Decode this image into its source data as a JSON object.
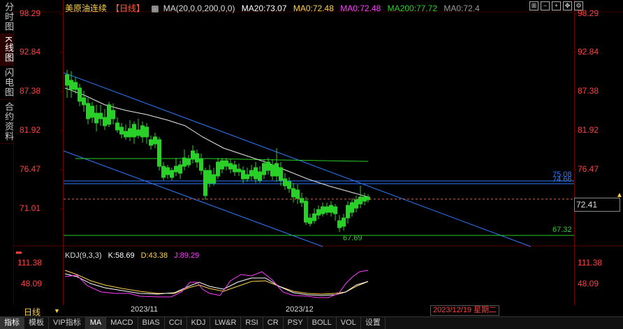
{
  "side_tabs": [
    "分时图",
    "K线图",
    "闪电图",
    "合约资料"
  ],
  "side_active_index": 1,
  "header": {
    "title": "美原油连续",
    "period_tag": "【日线】",
    "ma_params": "MA(20,0,0,200,0,0)",
    "ma20": "MA20:73.07",
    "ma0a": "MA0:72.48",
    "ma0b": "MA0:72.48",
    "ma200": "MA200:77.72",
    "ma0c": "MA0:72.4",
    "colors": {
      "ma20": "#ffffff",
      "ma0a": "#ffd24a",
      "ma0b": "#ff3cff",
      "ma200": "#28d028",
      "ma0c": "#9a9a9a"
    }
  },
  "toolbar_icons": [
    "expand-icon",
    "minus-icon",
    "plus-icon",
    "move-icon",
    "settings-icon"
  ],
  "price_axis": [
    "98.29",
    "92.84",
    "87.38",
    "81.92",
    "76.47",
    "71.01"
  ],
  "current_price": "72.41",
  "level_labels": {
    "upper_a": "75.08",
    "upper_b": "74.66",
    "support": "67.32",
    "low": "67.69"
  },
  "kdj": {
    "title": "KDJ(9,3,3)",
    "k": "K:58.69",
    "d": "D:43.38",
    "j": "J:89.29",
    "axis": [
      "111.38",
      "48.09"
    ]
  },
  "dates": [
    "2023/11",
    "2023/12"
  ],
  "current_date": "2023/12/19 星期二",
  "period_label": "日线",
  "indicator_tabs": [
    "指标",
    "模板",
    "VIP指标",
    "MA",
    "MACD",
    "BIAS",
    "CCI",
    "KDJ",
    "LW&R",
    "RSI",
    "CR",
    "PSY",
    "BOLL",
    "VOL",
    "设置"
  ],
  "indicator_active": "指标",
  "indicator_selected": "MA"
}
